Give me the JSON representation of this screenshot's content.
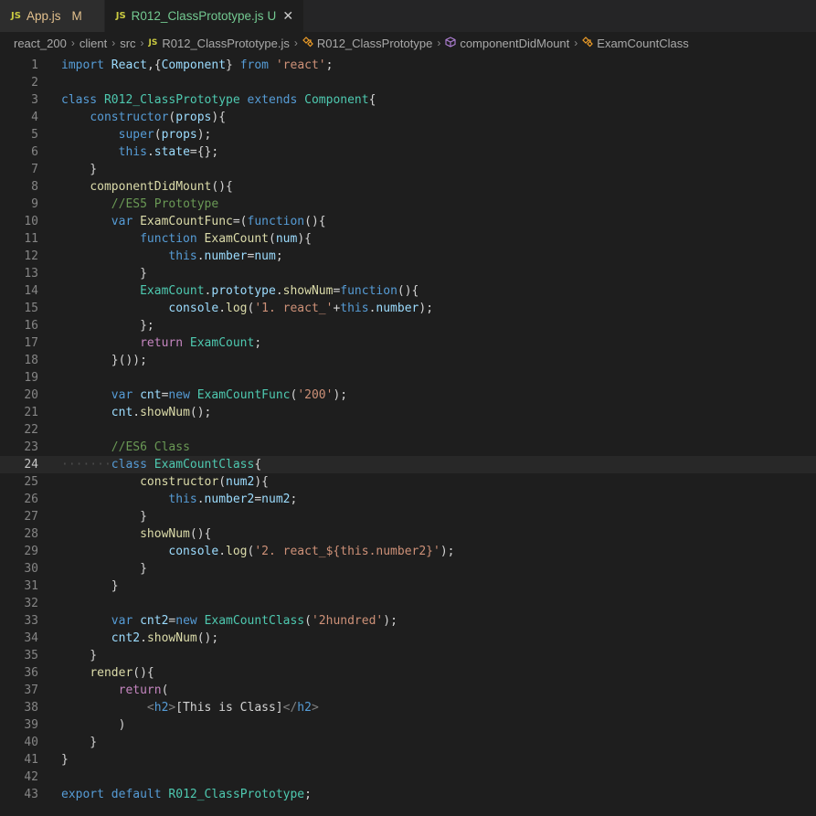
{
  "tabs": [
    {
      "icon": "JS",
      "name": "App.js",
      "status": "M",
      "active": false
    },
    {
      "icon": "JS",
      "name": "R012_ClassPrototype.js",
      "status": "U",
      "active": true
    }
  ],
  "breadcrumb": {
    "folder1": "react_200",
    "folder2": "client",
    "folder3": "src",
    "file": "R012_ClassPrototype.js",
    "symbol1": "R012_ClassPrototype",
    "symbol2": "componentDidMount",
    "symbol3": "ExamCountClass"
  },
  "current_line": 24,
  "lines": [
    [
      [
        "kw",
        "import "
      ],
      [
        "var",
        "React"
      ],
      [
        "plain",
        ",{"
      ],
      [
        "var",
        "Component"
      ],
      [
        "plain",
        "} "
      ],
      [
        "kw",
        "from "
      ],
      [
        "str",
        "'react'"
      ],
      [
        "plain",
        ";"
      ]
    ],
    [],
    [
      [
        "kw",
        "class "
      ],
      [
        "cls",
        "R012_ClassPrototype "
      ],
      [
        "kw",
        "extends "
      ],
      [
        "cls",
        "Component"
      ],
      [
        "plain",
        "{"
      ]
    ],
    [
      [
        "plain",
        "    "
      ],
      [
        "kw",
        "constructor"
      ],
      [
        "plain",
        "("
      ],
      [
        "var",
        "props"
      ],
      [
        "plain",
        "){"
      ]
    ],
    [
      [
        "plain",
        "        "
      ],
      [
        "kw",
        "super"
      ],
      [
        "plain",
        "("
      ],
      [
        "var",
        "props"
      ],
      [
        "plain",
        ");"
      ]
    ],
    [
      [
        "plain",
        "        "
      ],
      [
        "kw",
        "this"
      ],
      [
        "plain",
        "."
      ],
      [
        "var",
        "state"
      ],
      [
        "plain",
        "={};"
      ]
    ],
    [
      [
        "plain",
        "    }"
      ]
    ],
    [
      [
        "plain",
        "    "
      ],
      [
        "fn",
        "componentDidMount"
      ],
      [
        "plain",
        "(){"
      ]
    ],
    [
      [
        "plain",
        "       "
      ],
      [
        "cmt",
        "//ES5 Prototype"
      ]
    ],
    [
      [
        "plain",
        "       "
      ],
      [
        "kw",
        "var "
      ],
      [
        "fn",
        "ExamCountFunc"
      ],
      [
        "plain",
        "=("
      ],
      [
        "kw",
        "function"
      ],
      [
        "plain",
        "(){"
      ]
    ],
    [
      [
        "plain",
        "           "
      ],
      [
        "kw",
        "function "
      ],
      [
        "fn",
        "ExamCount"
      ],
      [
        "plain",
        "("
      ],
      [
        "var",
        "num"
      ],
      [
        "plain",
        "){"
      ]
    ],
    [
      [
        "plain",
        "               "
      ],
      [
        "kw",
        "this"
      ],
      [
        "plain",
        "."
      ],
      [
        "var",
        "number"
      ],
      [
        "plain",
        "="
      ],
      [
        "var",
        "num"
      ],
      [
        "plain",
        ";"
      ]
    ],
    [
      [
        "plain",
        "           }"
      ]
    ],
    [
      [
        "plain",
        "           "
      ],
      [
        "cls",
        "ExamCount"
      ],
      [
        "plain",
        "."
      ],
      [
        "var",
        "prototype"
      ],
      [
        "plain",
        "."
      ],
      [
        "fn",
        "showNum"
      ],
      [
        "plain",
        "="
      ],
      [
        "kw",
        "function"
      ],
      [
        "plain",
        "(){"
      ]
    ],
    [
      [
        "plain",
        "               "
      ],
      [
        "var",
        "console"
      ],
      [
        "plain",
        "."
      ],
      [
        "fn",
        "log"
      ],
      [
        "plain",
        "("
      ],
      [
        "str",
        "'1. react_'"
      ],
      [
        "plain",
        "+"
      ],
      [
        "kw",
        "this"
      ],
      [
        "plain",
        "."
      ],
      [
        "var",
        "number"
      ],
      [
        "plain",
        ");"
      ]
    ],
    [
      [
        "plain",
        "           };"
      ]
    ],
    [
      [
        "plain",
        "           "
      ],
      [
        "ctl",
        "return "
      ],
      [
        "cls",
        "ExamCount"
      ],
      [
        "plain",
        ";"
      ]
    ],
    [
      [
        "plain",
        "       }());"
      ]
    ],
    [],
    [
      [
        "plain",
        "       "
      ],
      [
        "kw",
        "var "
      ],
      [
        "var",
        "cnt"
      ],
      [
        "plain",
        "="
      ],
      [
        "kw",
        "new "
      ],
      [
        "cls",
        "ExamCountFunc"
      ],
      [
        "plain",
        "("
      ],
      [
        "str",
        "'200'"
      ],
      [
        "plain",
        ");"
      ]
    ],
    [
      [
        "plain",
        "       "
      ],
      [
        "var",
        "cnt"
      ],
      [
        "plain",
        "."
      ],
      [
        "fn",
        "showNum"
      ],
      [
        "plain",
        "();"
      ]
    ],
    [],
    [
      [
        "plain",
        "       "
      ],
      [
        "cmt",
        "//ES6 Class"
      ]
    ],
    [
      [
        "ws",
        "·······"
      ],
      [
        "kw",
        "class "
      ],
      [
        "cls",
        "ExamCountClass"
      ],
      [
        "plain",
        "{"
      ]
    ],
    [
      [
        "plain",
        "           "
      ],
      [
        "fn",
        "constructor"
      ],
      [
        "plain",
        "("
      ],
      [
        "var",
        "num2"
      ],
      [
        "plain",
        "){"
      ]
    ],
    [
      [
        "plain",
        "               "
      ],
      [
        "kw",
        "this"
      ],
      [
        "plain",
        "."
      ],
      [
        "var",
        "number2"
      ],
      [
        "plain",
        "="
      ],
      [
        "var",
        "num2"
      ],
      [
        "plain",
        ";"
      ]
    ],
    [
      [
        "plain",
        "           }"
      ]
    ],
    [
      [
        "plain",
        "           "
      ],
      [
        "fn",
        "showNum"
      ],
      [
        "plain",
        "(){"
      ]
    ],
    [
      [
        "plain",
        "               "
      ],
      [
        "var",
        "console"
      ],
      [
        "plain",
        "."
      ],
      [
        "fn",
        "log"
      ],
      [
        "plain",
        "("
      ],
      [
        "str",
        "'2. react_${this.number2}'"
      ],
      [
        "plain",
        ");"
      ]
    ],
    [
      [
        "plain",
        "           }"
      ]
    ],
    [
      [
        "plain",
        "       }"
      ]
    ],
    [],
    [
      [
        "plain",
        "       "
      ],
      [
        "kw",
        "var "
      ],
      [
        "var",
        "cnt2"
      ],
      [
        "plain",
        "="
      ],
      [
        "kw",
        "new "
      ],
      [
        "cls",
        "ExamCountClass"
      ],
      [
        "plain",
        "("
      ],
      [
        "str",
        "'2hundred'"
      ],
      [
        "plain",
        ");"
      ]
    ],
    [
      [
        "plain",
        "       "
      ],
      [
        "var",
        "cnt2"
      ],
      [
        "plain",
        "."
      ],
      [
        "fn",
        "showNum"
      ],
      [
        "plain",
        "();"
      ]
    ],
    [
      [
        "plain",
        "    }"
      ]
    ],
    [
      [
        "plain",
        "    "
      ],
      [
        "fn",
        "render"
      ],
      [
        "plain",
        "(){"
      ]
    ],
    [
      [
        "plain",
        "        "
      ],
      [
        "ctl",
        "return"
      ],
      [
        "plain",
        "("
      ]
    ],
    [
      [
        "plain",
        "            "
      ],
      [
        "tag",
        "<"
      ],
      [
        "tagname",
        "h2"
      ],
      [
        "tag",
        ">"
      ],
      [
        "plain",
        "[This is Class]"
      ],
      [
        "tag",
        "</"
      ],
      [
        "tagname",
        "h2"
      ],
      [
        "tag",
        ">"
      ]
    ],
    [
      [
        "plain",
        "        )"
      ]
    ],
    [
      [
        "plain",
        "    }"
      ]
    ],
    [
      [
        "plain",
        "}"
      ]
    ],
    [],
    [
      [
        "kw",
        "export "
      ],
      [
        "kw",
        "default "
      ],
      [
        "cls",
        "R012_ClassPrototype"
      ],
      [
        "plain",
        ";"
      ]
    ]
  ]
}
